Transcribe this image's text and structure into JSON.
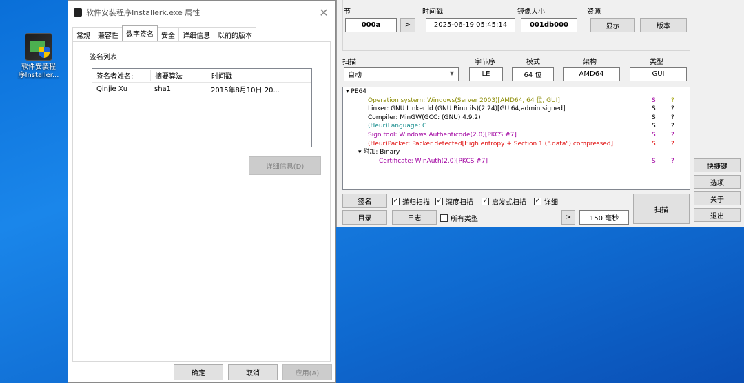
{
  "desktop": {
    "icon_label_line1": "软件安装程",
    "icon_label_line2": "序Installer..."
  },
  "properties_dialog": {
    "title": "软件安装程序Installerk.exe 属性",
    "tabs": [
      "常规",
      "兼容性",
      "数字签名",
      "安全",
      "详细信息",
      "以前的版本"
    ],
    "active_tab": "数字签名",
    "group_title": "签名列表",
    "columns": [
      "签名者姓名:",
      "摘要算法",
      "时间戳"
    ],
    "rows": [
      {
        "signer": "Qinjie Xu",
        "digest": "sha1",
        "timestamp": "2015年8月10日 20..."
      }
    ],
    "details_button": "详细信息(D)",
    "ok_button": "确定",
    "cancel_button": "取消",
    "apply_button": "应用(A)"
  },
  "die": {
    "section_label": "节",
    "section_value": "000a",
    "section_nav": ">",
    "timestamp_label": "时间戳",
    "timestamp_value": "2025-06-19 05:45:14",
    "image_size_label": "镜像大小",
    "image_size_value": "001db000",
    "resources_label": "资源",
    "show_button": "显示",
    "version_button": "版本",
    "scan_label": "扫描",
    "scan_mode": "自动",
    "endian_label": "字节序",
    "endian_value": "LE",
    "mode_label": "模式",
    "mode_value": "64 位",
    "arch_label": "架构",
    "arch_value": "AMD64",
    "type_label": "类型",
    "type_value": "GUI",
    "tree_root": "PE64",
    "results": [
      {
        "text": "Operation system: Windows(Server 2003)[AMD64, 64 位, GUI]",
        "color": "#8a8a00",
        "s": "S",
        "q": "?"
      },
      {
        "text": "Linker: GNU Linker ld (GNU Binutils)(2.24)[GUI64,admin,signed]",
        "color": "#000000",
        "s": "S",
        "q": "?"
      },
      {
        "text": "Compiler: MinGW(GCC: (GNU) 4.9.2)",
        "color": "#000000",
        "s": "S",
        "q": "?"
      },
      {
        "text": "(Heur)Language: C",
        "color": "#1a8f8f",
        "s": "S",
        "q": "?"
      },
      {
        "text": "Sign tool: Windows Authenticode(2.0)[PKCS #7]",
        "color": "#a000a0",
        "s": "S",
        "q": "?"
      },
      {
        "text": "(Heur)Packer: Packer detected[High entropy + Section 1 (\".data\") compressed]",
        "color": "#e01010",
        "s": "S",
        "q": "?"
      }
    ],
    "overlay_node": "附加: Binary",
    "certificate": {
      "text": "Certificate: WinAuth(2.0)[PKCS #7]",
      "color": "#a000a0",
      "s": "S",
      "q": "?"
    },
    "signature_button": "签名",
    "recursive_scan": "递归扫描",
    "deep_scan": "深度扫描",
    "heuristic_scan": "启发式扫描",
    "verbose": "详细",
    "scan_button": "扫描",
    "directory_button": "目录",
    "log_button": "日志",
    "all_types": "所有类型",
    "time_nav": ">",
    "elapsed": "150 毫秒",
    "side_buttons": [
      "快捷键",
      "选项",
      "关于",
      "退出"
    ],
    "colors": {
      "s_color": "#a000a0",
      "q_color": "#a0a000"
    }
  }
}
